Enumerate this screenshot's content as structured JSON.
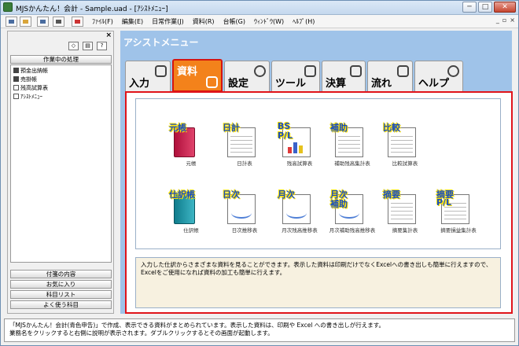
{
  "window": {
    "title": "MJSかんたん！会計 - Sample.uad - [ｱｼｽﾄﾒﾆｭｰ]"
  },
  "menu": [
    "ﾌｧｲﾙ(F)",
    "編集(E)",
    "日常作業(J)",
    "資料(R)",
    "台帳(G)",
    "ｳｨﾝﾄﾞｳ(W)",
    "ﾍﾙﾌﾟ(H)"
  ],
  "left": {
    "working_header": "作業中の処理",
    "working_items": [
      "預金出納帳",
      "売掛帳",
      "残高試算表",
      "ｱｼｽﾄﾒﾆｭｰ"
    ],
    "bottom_buttons": [
      "付箋の内容",
      "お気に入り",
      "科目リスト",
      "よく使う科目"
    ]
  },
  "main": {
    "title": "アシストメニュー",
    "tabs": [
      {
        "label": "入力",
        "icon": "mouse-icon",
        "active": false
      },
      {
        "label": "資料",
        "icon": "book-icon",
        "active": true
      },
      {
        "label": "設定",
        "icon": "gear-icon",
        "active": false
      },
      {
        "label": "ツール",
        "icon": "wrench-icon",
        "active": false
      },
      {
        "label": "決算",
        "icon": "document-icon",
        "active": false
      },
      {
        "label": "流れ",
        "icon": "flow-icon",
        "active": false
      },
      {
        "label": "ヘルプ",
        "icon": "question-icon",
        "active": false
      }
    ],
    "reports": [
      {
        "label": "元帳",
        "label2": "",
        "caption": "元帳"
      },
      {
        "label": "日計",
        "label2": "",
        "caption": "日計表"
      },
      {
        "label": "BS",
        "label2": "P/L",
        "caption": "残高試算表"
      },
      {
        "label": "補助",
        "label2": "",
        "caption": "補助残高集計表"
      },
      {
        "label": "比較",
        "label2": "",
        "caption": "比較試算表"
      },
      {
        "label": "仕訳帳",
        "label2": "",
        "caption": "仕訳帳"
      },
      {
        "label": "日次",
        "label2": "",
        "caption": "日次推移表"
      },
      {
        "label": "月次",
        "label2": "",
        "caption": "月次残高推移表"
      },
      {
        "label": "月次",
        "label2": "補助",
        "caption": "月次補助残高推移表"
      },
      {
        "label": "摘要",
        "label2": "",
        "caption": "摘要集計表"
      },
      {
        "label": "摘要",
        "label2": "P/L",
        "caption": "摘要損益集計表"
      }
    ],
    "description": "入力した仕訳からさまざまな資料を見ることができます。表示した資料は印刷だけでなくExcelへの書き出しも簡単に行えますので、Excelをご使用になれば資料の加工も簡単に行えます。"
  },
  "status": {
    "line1": "「MJSかんたん！会計(青色申告)」で作成、表示できる資料がまとめられています。表示した資料は、印刷や Excel への書き出しが行えます。",
    "line2": "業務名をクリックすると右側に説明が表示されます。ダブルクリックするとその画面が起動します。"
  },
  "colors": {
    "active_tab": "#f3821b",
    "highlight": "#e0141a",
    "main_bg": "#9fc3e9"
  }
}
